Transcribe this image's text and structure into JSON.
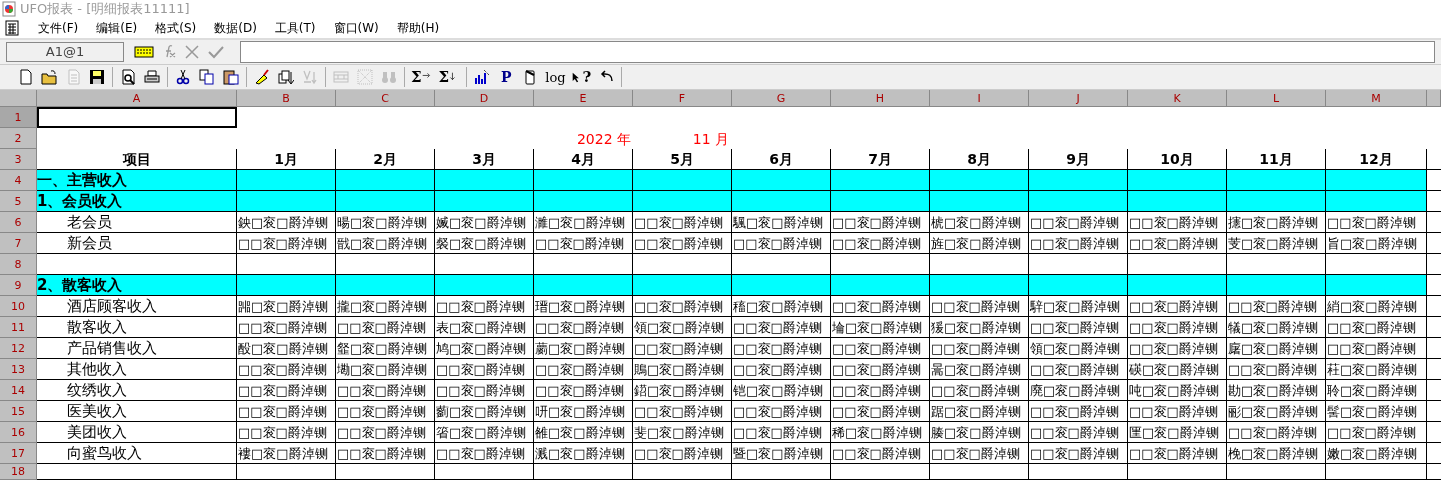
{
  "window": {
    "title": "UFO报表 - [明细报表11111]"
  },
  "menu": [
    {
      "label": "文件(F)"
    },
    {
      "label": "编辑(E)"
    },
    {
      "label": "格式(S)"
    },
    {
      "label": "数据(D)"
    },
    {
      "label": "工具(T)"
    },
    {
      "label": "窗口(W)"
    },
    {
      "label": "帮助(H)"
    }
  ],
  "formula_bar": {
    "cell_ref": "A1@1"
  },
  "toolbar": [
    [
      {
        "disabled": false
      },
      {
        "disabled": false
      },
      {
        "disabled": true
      },
      {
        "disabled": false
      }
    ],
    [
      {
        "disabled": false
      },
      {
        "disabled": false
      }
    ],
    [
      {
        "disabled": false
      },
      {
        "disabled": false
      },
      {
        "disabled": false
      }
    ],
    [
      {
        "disabled": false
      },
      {
        "disabled": false
      },
      {
        "disabled": true
      }
    ],
    [
      {
        "disabled": true
      },
      {
        "disabled": true
      },
      {
        "disabled": true
      }
    ],
    [
      {
        "glyph": "Σ",
        "disabled": false
      },
      {
        "glyph": "Σ",
        "disabled": false
      }
    ],
    [
      {
        "disabled": false
      },
      {
        "glyph": "P",
        "disabled": false
      },
      {
        "disabled": false
      },
      {
        "glyph": "log",
        "disabled": false
      },
      {
        "glyph": "?",
        "disabled": false
      },
      {
        "disabled": false
      }
    ]
  ],
  "sheet": {
    "columns": [
      "A",
      "B",
      "C",
      "D",
      "E",
      "F",
      "G",
      "H",
      "I",
      "J",
      "K",
      "L",
      "M"
    ],
    "rows": [
      {
        "number": "1",
        "kind": "blank",
        "selected": true
      },
      {
        "number": "2",
        "kind": "title",
        "selected": false,
        "year": "2022 年",
        "month": "11 月"
      },
      {
        "number": "3",
        "kind": "header",
        "selected": false,
        "label": "项目",
        "cells": [
          "1月",
          "2月",
          "3月",
          "4月",
          "5月",
          "6月",
          "7月",
          "8月",
          "9月",
          "10月",
          "11月",
          "12月"
        ]
      },
      {
        "number": "4",
        "kind": "section",
        "selected": false,
        "label": "一、主营收入"
      },
      {
        "number": "5",
        "kind": "section",
        "selected": false,
        "label": "1、会员收入"
      },
      {
        "number": "6",
        "kind": "item",
        "selected": false,
        "label": "老会员",
        "cells": [
          "鉠□衮□爵淖铡",
          "暘□衮□爵淖铡",
          "媙□衮□爵淖铡",
          "濉□衮□爵淖铡",
          "□□衮□爵淖铡",
          "颿□衮□爵淖铡",
          "□□衮□爵淖铡",
          "椃□衮□爵淖铡",
          "□□衮□爵淖铡",
          "□□衮□爵淖铡",
          "攇□衮□爵淖铡",
          "□□衮□爵淖铡"
        ]
      },
      {
        "number": "7",
        "kind": "item",
        "selected": false,
        "label": "新会员",
        "cells": [
          "□□衮□爵淖铡",
          "戩□衮□爵淖铡",
          "裻□衮□爵淖铡",
          "□□衮□爵淖铡",
          "□□衮□爵淖铡",
          "□□衮□爵淖铡",
          "□□衮□爵淖铡",
          "旌□衮□爵淖铡",
          "□□衮□爵淖铡",
          "□□衮□爵淖铡",
          "芰□衮□爵淖铡",
          "旨□衮□爵淖铡"
        ]
      },
      {
        "number": "8",
        "kind": "blank",
        "selected": false
      },
      {
        "number": "9",
        "kind": "section",
        "selected": false,
        "label": "2、散客收入"
      },
      {
        "number": "10",
        "kind": "item",
        "selected": false,
        "label": "酒店顾客收入",
        "cells": [
          "嘂□衮□爵淖铡",
          "攏□衮□爵淖铡",
          "□□衮□爵淖铡",
          "瑨□衮□爵淖铡",
          "□□衮□爵淖铡",
          "稸□衮□爵淖铡",
          "□□衮□爵淖铡",
          "□□衮□爵淖铡",
          "騂□衮□爵淖铡",
          "□□衮□爵淖铡",
          "□□衮□爵淖铡",
          "綃□衮□爵淖铡"
        ]
      },
      {
        "number": "11",
        "kind": "item",
        "selected": false,
        "label": "散客收入",
        "cells": [
          "□□衮□爵淖铡",
          "□□衮□爵淖铡",
          "表□衮□爵淖铡",
          "□□衮□爵淖铡",
          "領□衮□爵淖铡",
          "□□衮□爵淖铡",
          "埨□衮□爵淖铡",
          "猨□衮□爵淖铡",
          "□□衮□爵淖铡",
          "□□衮□爵淖铡",
          "犠□衮□爵淖铡",
          "□□衮□爵淖铡"
        ]
      },
      {
        "number": "12",
        "kind": "item",
        "selected": false,
        "label": "产品销售收入",
        "cells": [
          "酘□衮□爵淖铡",
          "韰□衮□爵淖铡",
          "鸠□衮□爵淖铡",
          "蘮□衮□爵淖铡",
          "□□衮□爵淖铡",
          "□□衮□爵淖铡",
          "□□衮□爵淖铡",
          "□□衮□爵淖铡",
          "領□衮□爵淖铡",
          "□□衮□爵淖铡",
          "廜□衮□爵淖铡",
          "□□衮□爵淖铡"
        ]
      },
      {
        "number": "13",
        "kind": "item",
        "selected": false,
        "label": "其他收入",
        "cells": [
          "□□衮□爵淖铡",
          "墈□衮□爵淖铡",
          "□□衮□爵淖铡",
          "□□衮□爵淖铡",
          "鵙□衮□爵淖铡",
          "□□衮□爵淖铡",
          "□□衮□爵淖铡",
          "暠□衮□爵淖铡",
          "□□衮□爵淖铡",
          "碤□衮□爵淖铡",
          "□□衮□爵淖铡",
          "荰□衮□爵淖铡"
        ]
      },
      {
        "number": "14",
        "kind": "item",
        "selected": false,
        "label": "纹绣收入",
        "cells": [
          "□□衮□爵淖铡",
          "□□衮□爵淖铡",
          "□□衮□爵淖铡",
          "□□衮□爵淖铡",
          "鍣□衮□爵淖铡",
          "铠□衮□爵淖铡",
          "□□衮□爵淖铡",
          "□□衮□爵淖铡",
          "廃□衮□爵淖铡",
          "吨□衮□爵淖铡",
          "勘□衮□爵淖铡",
          "聆□衮□爵淖铡"
        ]
      },
      {
        "number": "15",
        "kind": "item",
        "selected": false,
        "label": "医美收入",
        "cells": [
          "□□衮□爵淖铡",
          "□□衮□爵淖铡",
          "藰□衮□爵淖铡",
          "咞□衮□爵淖铡",
          "□□衮□爵淖铡",
          "□□衮□爵淖铡",
          "□□衮□爵淖铡",
          "踞□衮□爵淖铡",
          "□□衮□爵淖铡",
          "□□衮□爵淖铡",
          "彨□衮□爵淖铡",
          "髺□衮□爵淖铡"
        ]
      },
      {
        "number": "16",
        "kind": "item",
        "selected": false,
        "label": "美团收入",
        "cells": [
          "□□衮□爵淖铡",
          "□□衮□爵淖铡",
          "箵□衮□爵淖铡",
          "雒□衮□爵淖铡",
          "斐□衮□爵淖铡",
          "□□衮□爵淖铡",
          "稀□衮□爵淖铡",
          "腠□衮□爵淖铡",
          "□□衮□爵淖铡",
          "匩□衮□爵淖铡",
          "□□衮□爵淖铡",
          "□□衮□爵淖铡"
        ]
      },
      {
        "number": "17",
        "kind": "item",
        "selected": false,
        "label": "向蜜鸟收入",
        "cells": [
          "褸□衮□爵淖铡",
          "□□衮□爵淖铡",
          "□□衮□爵淖铡",
          "溅□衮□爵淖铡",
          "□□衮□爵淖铡",
          "暨□衮□爵淖铡",
          "□□衮□爵淖铡",
          "□□衮□爵淖铡",
          "□□衮□爵淖铡",
          "□□衮□爵淖铡",
          "梚□衮□爵淖铡",
          "嫩□衮□爵淖铡"
        ]
      },
      {
        "number": "18",
        "kind": "blank",
        "selected": false
      }
    ]
  }
}
